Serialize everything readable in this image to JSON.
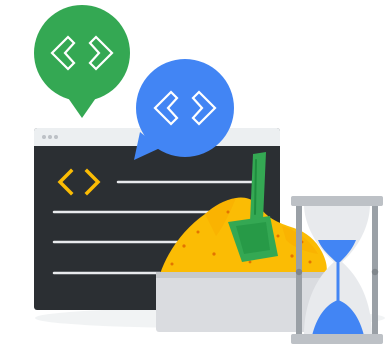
{
  "illustration": {
    "icons": [
      "code-brackets-icon",
      "code-brackets-icon",
      "code-brackets-icon",
      "sandbox-icon",
      "shovel-icon",
      "hourglass-icon"
    ],
    "colors": {
      "green": "#34a853",
      "blue": "#4285f4",
      "yellow": "#fbbc04",
      "dark_window": "#2b2f33",
      "window_titlebar": "#eceff1",
      "sandbox_gray": "#dadce0",
      "hourglass_frame": "#9aa0a6",
      "code_lines": "#e8eaed",
      "white": "#ffffff"
    }
  }
}
